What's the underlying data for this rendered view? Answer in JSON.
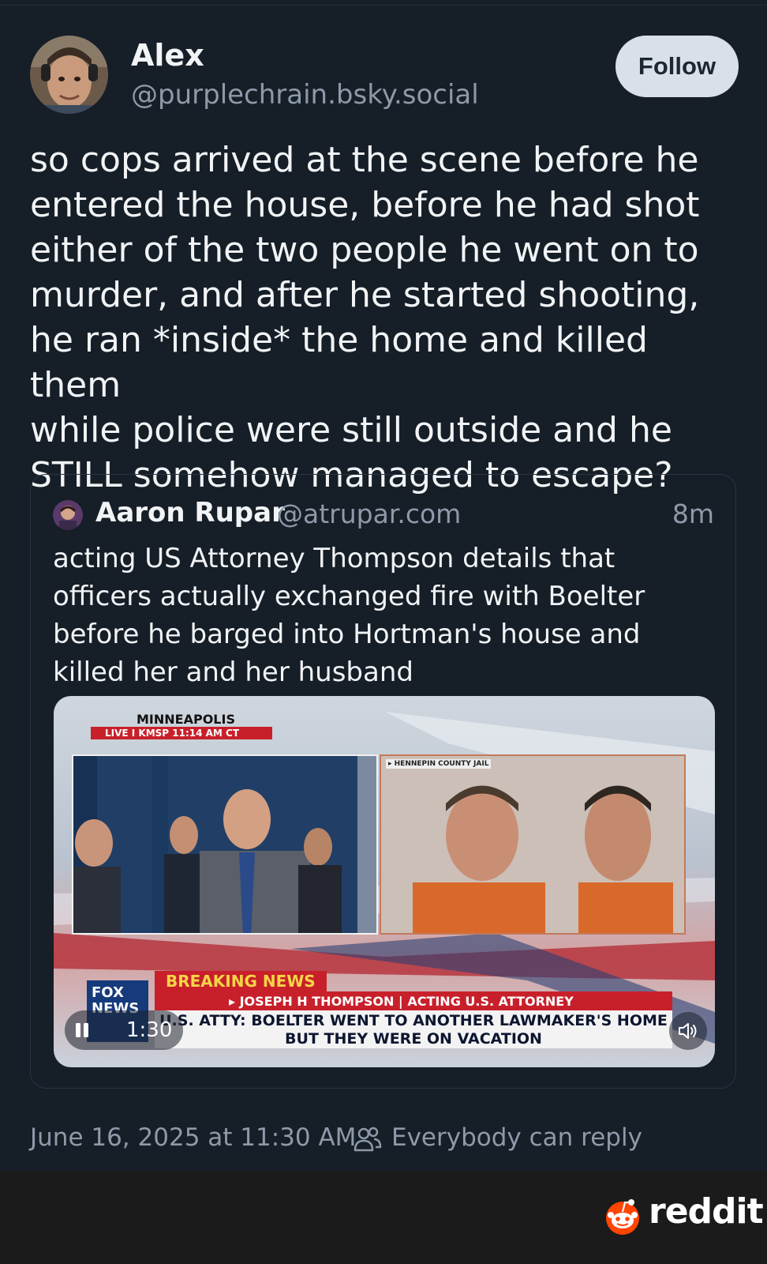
{
  "post": {
    "author_name": "Alex",
    "author_handle": "@purplechrain.bsky.social",
    "follow_label": "Follow",
    "text": "so cops arrived at the scene before he\nentered the house, before he had shot\neither of the two people he went on to\nmurder, and after he started shooting,\nhe ran *inside* the home and killed them\nwhile police were still outside and he\nSTILL somehow managed to escape?",
    "timestamp": "June 16, 2025 at 11:30 AM",
    "reply_setting": "Everybody can reply"
  },
  "quote": {
    "author_name": "Aaron Rupar",
    "author_handle": "@atrupar.com",
    "time": "8m",
    "text": "acting US Attorney Thompson details that\nofficers actually exchanged fire with Boelter\nbefore he barged into Hortman's house and\nkilled her and her husband",
    "video": {
      "live_city": "MINNEAPOLIS",
      "live_bar": "LIVE  I  KMSP   11:14 AM CT",
      "jail_label": "▸ HENNEPIN COUNTY JAIL",
      "breaking": "BREAKING NEWS",
      "name_bar": "▸ JOSEPH H THOMPSON  |  ACTING U.S. ATTORNEY",
      "headline": "U.S. ATTY: BOELTER WENT TO ANOTHER LAWMAKER'S HOME\nBUT THEY WERE ON VACATION",
      "network_logo": "FOX NEWS",
      "time": "1:30"
    }
  },
  "watermark": {
    "brand": "reddit"
  },
  "colors": {
    "background": "#161e27",
    "text": "#f1f3f5",
    "muted": "#8d9aa9",
    "follow_bg": "#d9e0e8",
    "reddit_orange": "#ff4500"
  }
}
